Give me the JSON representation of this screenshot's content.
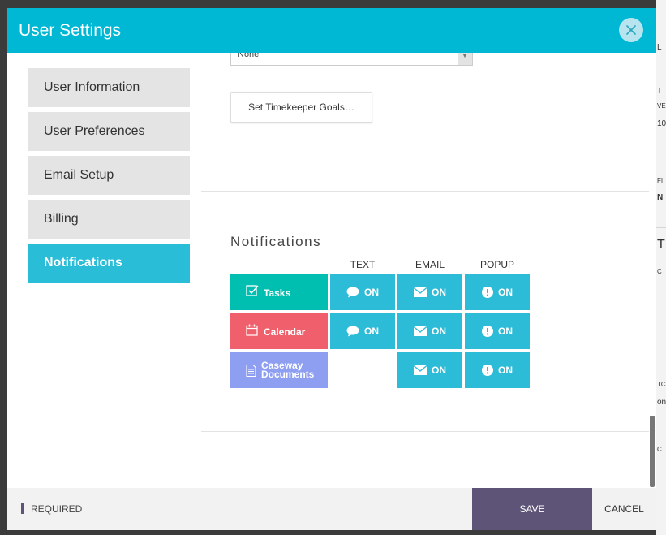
{
  "header": {
    "title": "User Settings",
    "close_icon": "close-icon"
  },
  "background": {
    "glimpses": [
      "L",
      "T",
      "VE",
      "10",
      "FI",
      "N",
      "T",
      "C",
      "TC",
      "on",
      "C"
    ]
  },
  "sidebar": {
    "items": [
      {
        "label": "User Information",
        "active": false
      },
      {
        "label": "User Preferences",
        "active": false
      },
      {
        "label": "Email Setup",
        "active": false
      },
      {
        "label": "Billing",
        "active": false
      },
      {
        "label": "Notifications",
        "active": true
      }
    ]
  },
  "content": {
    "select": {
      "value": "None"
    },
    "goals_button": "Set Timekeeper Goals…"
  },
  "notifications": {
    "title": "Notifications",
    "columns": [
      "TEXT",
      "EMAIL",
      "POPUP"
    ],
    "rows": [
      {
        "label_lines": [
          "Tasks"
        ],
        "color": "#00bfb0",
        "icon": "checkbox-icon",
        "text": "ON",
        "email": "ON",
        "popup": "ON"
      },
      {
        "label_lines": [
          "Calendar"
        ],
        "color": "#f0606c",
        "icon": "calendar-icon",
        "text": "ON",
        "email": "ON",
        "popup": "ON"
      },
      {
        "label_lines": [
          "Caseway",
          "Documents"
        ],
        "color": "#8e9ef0",
        "icon": "document-icon",
        "text": null,
        "email": "ON",
        "popup": "ON"
      }
    ],
    "cell_color": "#2dbcd7"
  },
  "footer": {
    "required": "REQUIRED",
    "save": "SAVE",
    "cancel": "CANCEL"
  },
  "colors": {
    "header": "#00b8d4",
    "active_nav": "#29bdd8",
    "save": "#5e5478"
  }
}
